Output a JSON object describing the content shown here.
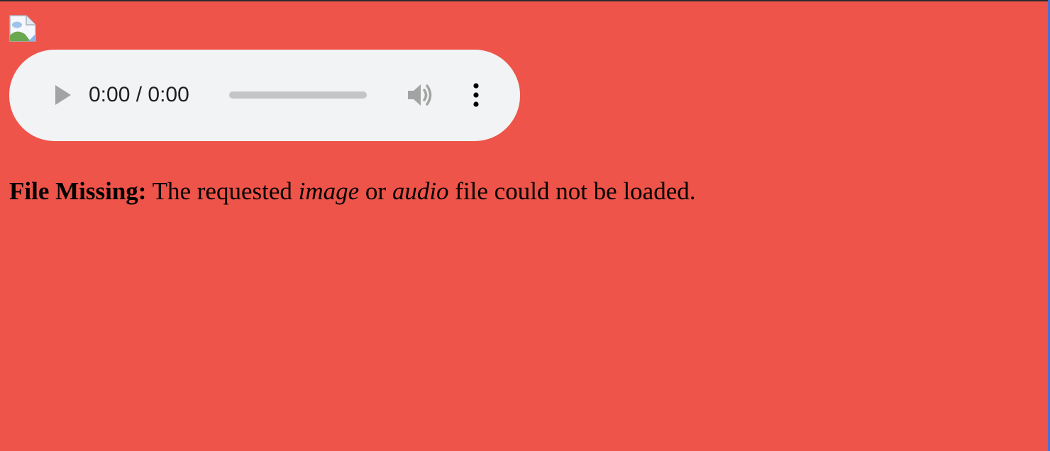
{
  "page": {
    "background_color": "#ee5449",
    "top_border_color": "#2b2b2b",
    "right_border_color": "#4a6fd1"
  },
  "image": {
    "icon": "broken-image-icon"
  },
  "audio_player": {
    "background_color": "#f1f3f4",
    "time_display": "0:00 / 0:00",
    "progress": 0,
    "icons": {
      "play": "play-icon",
      "volume": "volume-icon",
      "menu": "more-vertical-icon"
    }
  },
  "message": {
    "label": "File Missing:",
    "text_1": " The requested ",
    "emphasis_1": "image",
    "text_2": " or ",
    "emphasis_2": "audio",
    "text_3": " file could not be loaded."
  }
}
